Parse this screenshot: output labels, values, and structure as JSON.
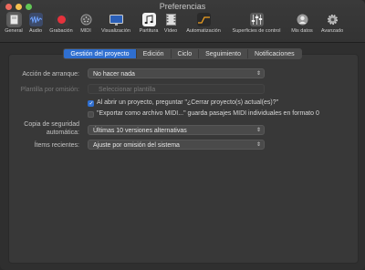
{
  "window": {
    "title": "Preferencias"
  },
  "colors": {
    "accent": "#2f6fd0",
    "close": "#ed6a5e",
    "minimize": "#f5bf4f",
    "zoom": "#62c655"
  },
  "toolbar": {
    "items": [
      {
        "label": "General",
        "icon": "general-icon"
      },
      {
        "label": "Audio",
        "icon": "audio-waveform-icon"
      },
      {
        "label": "Grabación",
        "icon": "record-icon"
      },
      {
        "label": "MIDI",
        "icon": "midi-icon"
      },
      {
        "label": "Visualización",
        "icon": "display-icon"
      },
      {
        "label": "Partitura",
        "icon": "score-icon"
      },
      {
        "label": "Vídeo",
        "icon": "video-icon"
      },
      {
        "label": "Automatización",
        "icon": "automation-icon"
      },
      {
        "label": "Superficies de control",
        "icon": "control-surfaces-icon"
      },
      {
        "label": "Mis datos",
        "icon": "user-icon"
      },
      {
        "label": "Avanzado",
        "icon": "gear-icon"
      }
    ]
  },
  "tabs": [
    {
      "label": "Gestión del proyecto",
      "active": true
    },
    {
      "label": "Edición",
      "active": false
    },
    {
      "label": "Ciclo",
      "active": false
    },
    {
      "label": "Seguimiento",
      "active": false
    },
    {
      "label": "Notificaciones",
      "active": false
    }
  ],
  "settings": {
    "startup_action": {
      "label": "Acción de arranque:",
      "value": "No hacer nada"
    },
    "default_template": {
      "label": "Plantilla por omisión:",
      "value": "Seleccionar plantilla"
    },
    "close_project_prompt": {
      "label": "Al abrir un proyecto, preguntar \"¿Cerrar proyecto(s) actual(es)?\"",
      "checked": true
    },
    "export_midi": {
      "label": "\"Exportar como archivo MIDI...\" guarda pasajes MIDI individuales en formato 0",
      "checked": false
    },
    "auto_backup": {
      "label_line1": "Copia de seguridad",
      "label_line2": "automática:",
      "value": "Últimas 10 versiones alternativas"
    },
    "recent_items": {
      "label": "Ítems recientes:",
      "value": "Ajuste por omisión del sistema"
    }
  }
}
